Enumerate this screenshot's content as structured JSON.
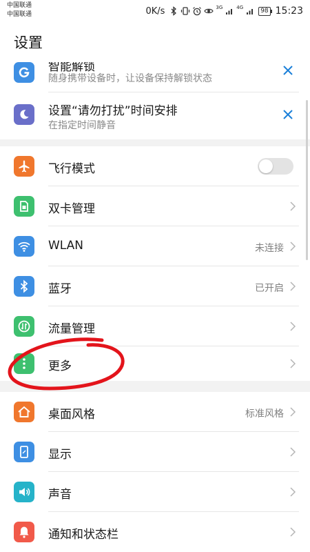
{
  "status_bar": {
    "carrier_1": "中国联通",
    "carrier_2": "中国联通",
    "speed": "0K/s",
    "network_1": "3G",
    "network_2": "4G",
    "battery": "98",
    "time": "15:23"
  },
  "page": {
    "title": "设置"
  },
  "suggestions": [
    {
      "title": "智能解锁",
      "subtitle": "随身携带设备时，让设备保持解锁状态",
      "icon": "g-icon"
    },
    {
      "title": "设置“请勿打扰”时间安排",
      "subtitle": "在指定时间静音",
      "icon": "moon-icon"
    }
  ],
  "network_group": {
    "airplane": {
      "label": "飞行模式",
      "on": false
    },
    "dual_sim": {
      "label": "双卡管理"
    },
    "wlan": {
      "label": "WLAN",
      "value": "未连接"
    },
    "bluetooth": {
      "label": "蓝牙",
      "value": "已开启"
    },
    "data_usage": {
      "label": "流量管理"
    },
    "more": {
      "label": "更多"
    }
  },
  "display_group": {
    "home_style": {
      "label": "桌面风格",
      "value": "标准风格"
    },
    "display": {
      "label": "显示"
    },
    "sound": {
      "label": "声音"
    },
    "notifications": {
      "label": "通知和状态栏"
    }
  },
  "colors": {
    "accent_blue": "#1a7fd9",
    "airplane_orange": "#f0772d",
    "green": "#3ec06f",
    "blue": "#3e8fe3",
    "teal": "#26b3c9",
    "red": "#f15a4a",
    "purple": "#6a6fc9",
    "annotation_red": "#e3141b"
  }
}
